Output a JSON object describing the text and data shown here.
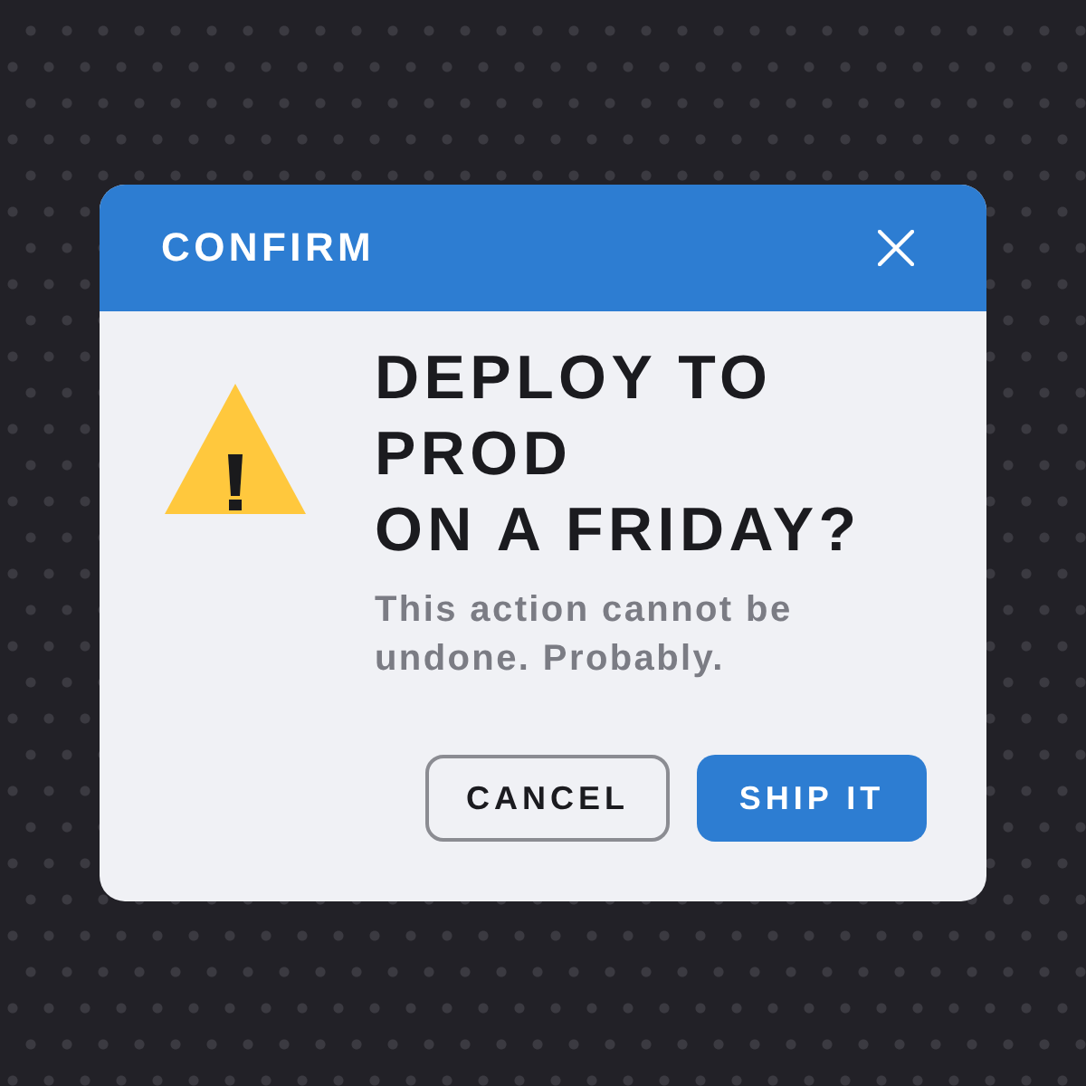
{
  "dialog": {
    "title": "CONFIRM",
    "heading_lines": [
      "DEPLOY TO PROD",
      "ON A FRIDAY?"
    ],
    "message": "This action cannot be undone. Probably.",
    "buttons": [
      {
        "label": "CANCEL",
        "kind": "secondary"
      },
      {
        "label": "SHIP IT",
        "kind": "primary"
      }
    ]
  }
}
